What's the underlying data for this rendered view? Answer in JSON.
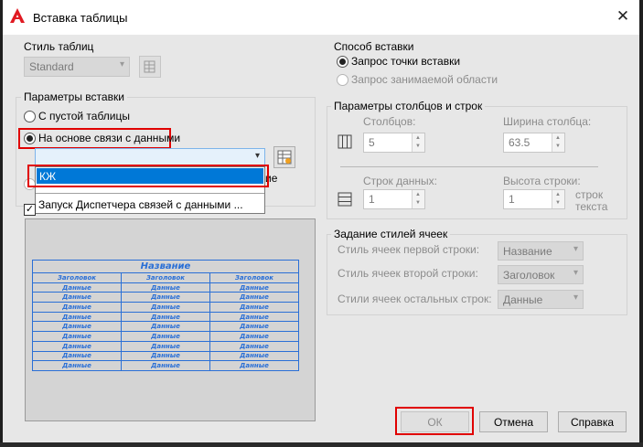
{
  "window": {
    "title": "Вставка таблицы",
    "close_icon": "close-icon",
    "logo_icon": "autocad-logo-icon"
  },
  "table_style": {
    "label": "Стиль таблиц",
    "value": "Standard"
  },
  "insert_params": {
    "label": "Параметры вставки",
    "empty_table": "С пустой таблицы",
    "data_link": "На основе связи с данными",
    "dropdown_value": "",
    "dropdown_options": [
      "КЖ",
      "Запуск Диспетчера связей с данными ..."
    ],
    "hidden_label_tail": "ие"
  },
  "preview": {
    "title": "Название",
    "header": [
      "Заголовок",
      "Заголовок",
      "Заголовок"
    ],
    "cell": "Данные",
    "rows": 9
  },
  "insert_method": {
    "label": "Способ вставки",
    "point": "Запрос точки вставки",
    "window": "Запрос занимаемой области"
  },
  "col_row": {
    "label": "Параметры столбцов и строк",
    "columns_label": "Столбцов:",
    "columns_value": "5",
    "col_width_label": "Ширина столбца:",
    "col_width_value": "63.5",
    "data_rows_label": "Строк данных:",
    "data_rows_value": "1",
    "row_height_label": "Высота строки:",
    "row_height_value": "1",
    "row_height_unit": "строк текста"
  },
  "cell_styles": {
    "label": "Задание стилей ячеек",
    "first_label": "Стиль ячеек первой строки:",
    "first_value": "Название",
    "second_label": "Стиль ячеек второй строки:",
    "second_value": "Заголовок",
    "other_label": "Стили ячеек остальных строк:",
    "other_value": "Данные"
  },
  "buttons": {
    "ok": "ОК",
    "cancel": "Отмена",
    "help": "Справка"
  },
  "colors": {
    "accent": "#0078d7",
    "highlight": "#e00000",
    "preview_blue": "#2a6fd6"
  }
}
